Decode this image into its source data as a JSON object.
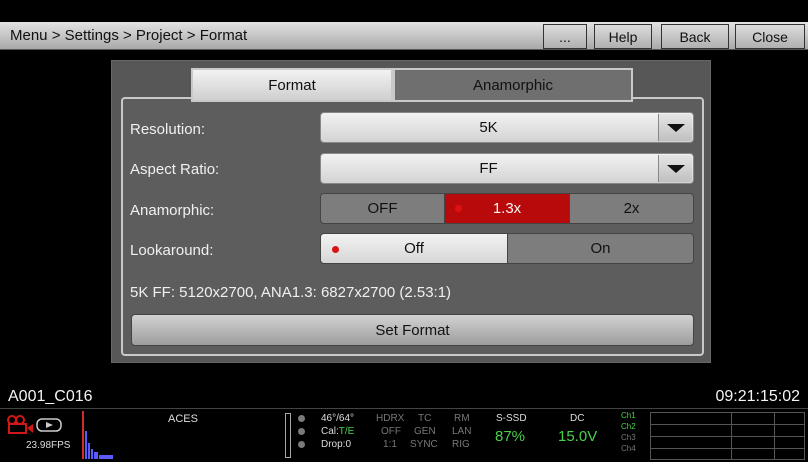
{
  "header": {
    "breadcrumb": "Menu > Settings > Project > Format",
    "buttons": {
      "more": "...",
      "help": "Help",
      "back": "Back",
      "close": "Close"
    }
  },
  "tabs": {
    "format": "Format",
    "anamorphic": "Anamorphic"
  },
  "settings": {
    "resolution": {
      "label": "Resolution:",
      "value": "5K"
    },
    "aspect_ratio": {
      "label": "Aspect Ratio:",
      "value": "FF"
    },
    "anamorphic": {
      "label": "Anamorphic:",
      "options": [
        "OFF",
        "1.3x",
        "2x"
      ],
      "selected": "1.3x"
    },
    "lookaround": {
      "label": "Lookaround:",
      "options": [
        "Off",
        "On"
      ],
      "selected": "Off"
    }
  },
  "format_info": "5K FF: 5120x2700, ANA1.3: 6827x2700 (2.53:1)",
  "set_format_label": "Set Format",
  "clip_name": "A001_C016",
  "timecode": "09:21:15:02",
  "status_bar": {
    "fps": "23.98FPS",
    "color_space": "ACES",
    "temp": "46°/64°",
    "cal": "Cal:",
    "cal_value": "T/E",
    "drop": "Drop:0",
    "col1": [
      "HDRX",
      "OFF",
      "1:1"
    ],
    "col2": [
      "TC",
      "GEN",
      "SYNC"
    ],
    "col3": [
      "RM",
      "LAN",
      "RIG"
    ],
    "media_label": "S-SSD",
    "media_value": "87%",
    "power_label": "DC",
    "power_value": "15.0V",
    "channels": [
      "Ch1",
      "Ch2",
      "Ch3",
      "Ch4"
    ]
  },
  "colors": {
    "accent_red": "#b80a0a",
    "status_green": "#49d14a"
  }
}
